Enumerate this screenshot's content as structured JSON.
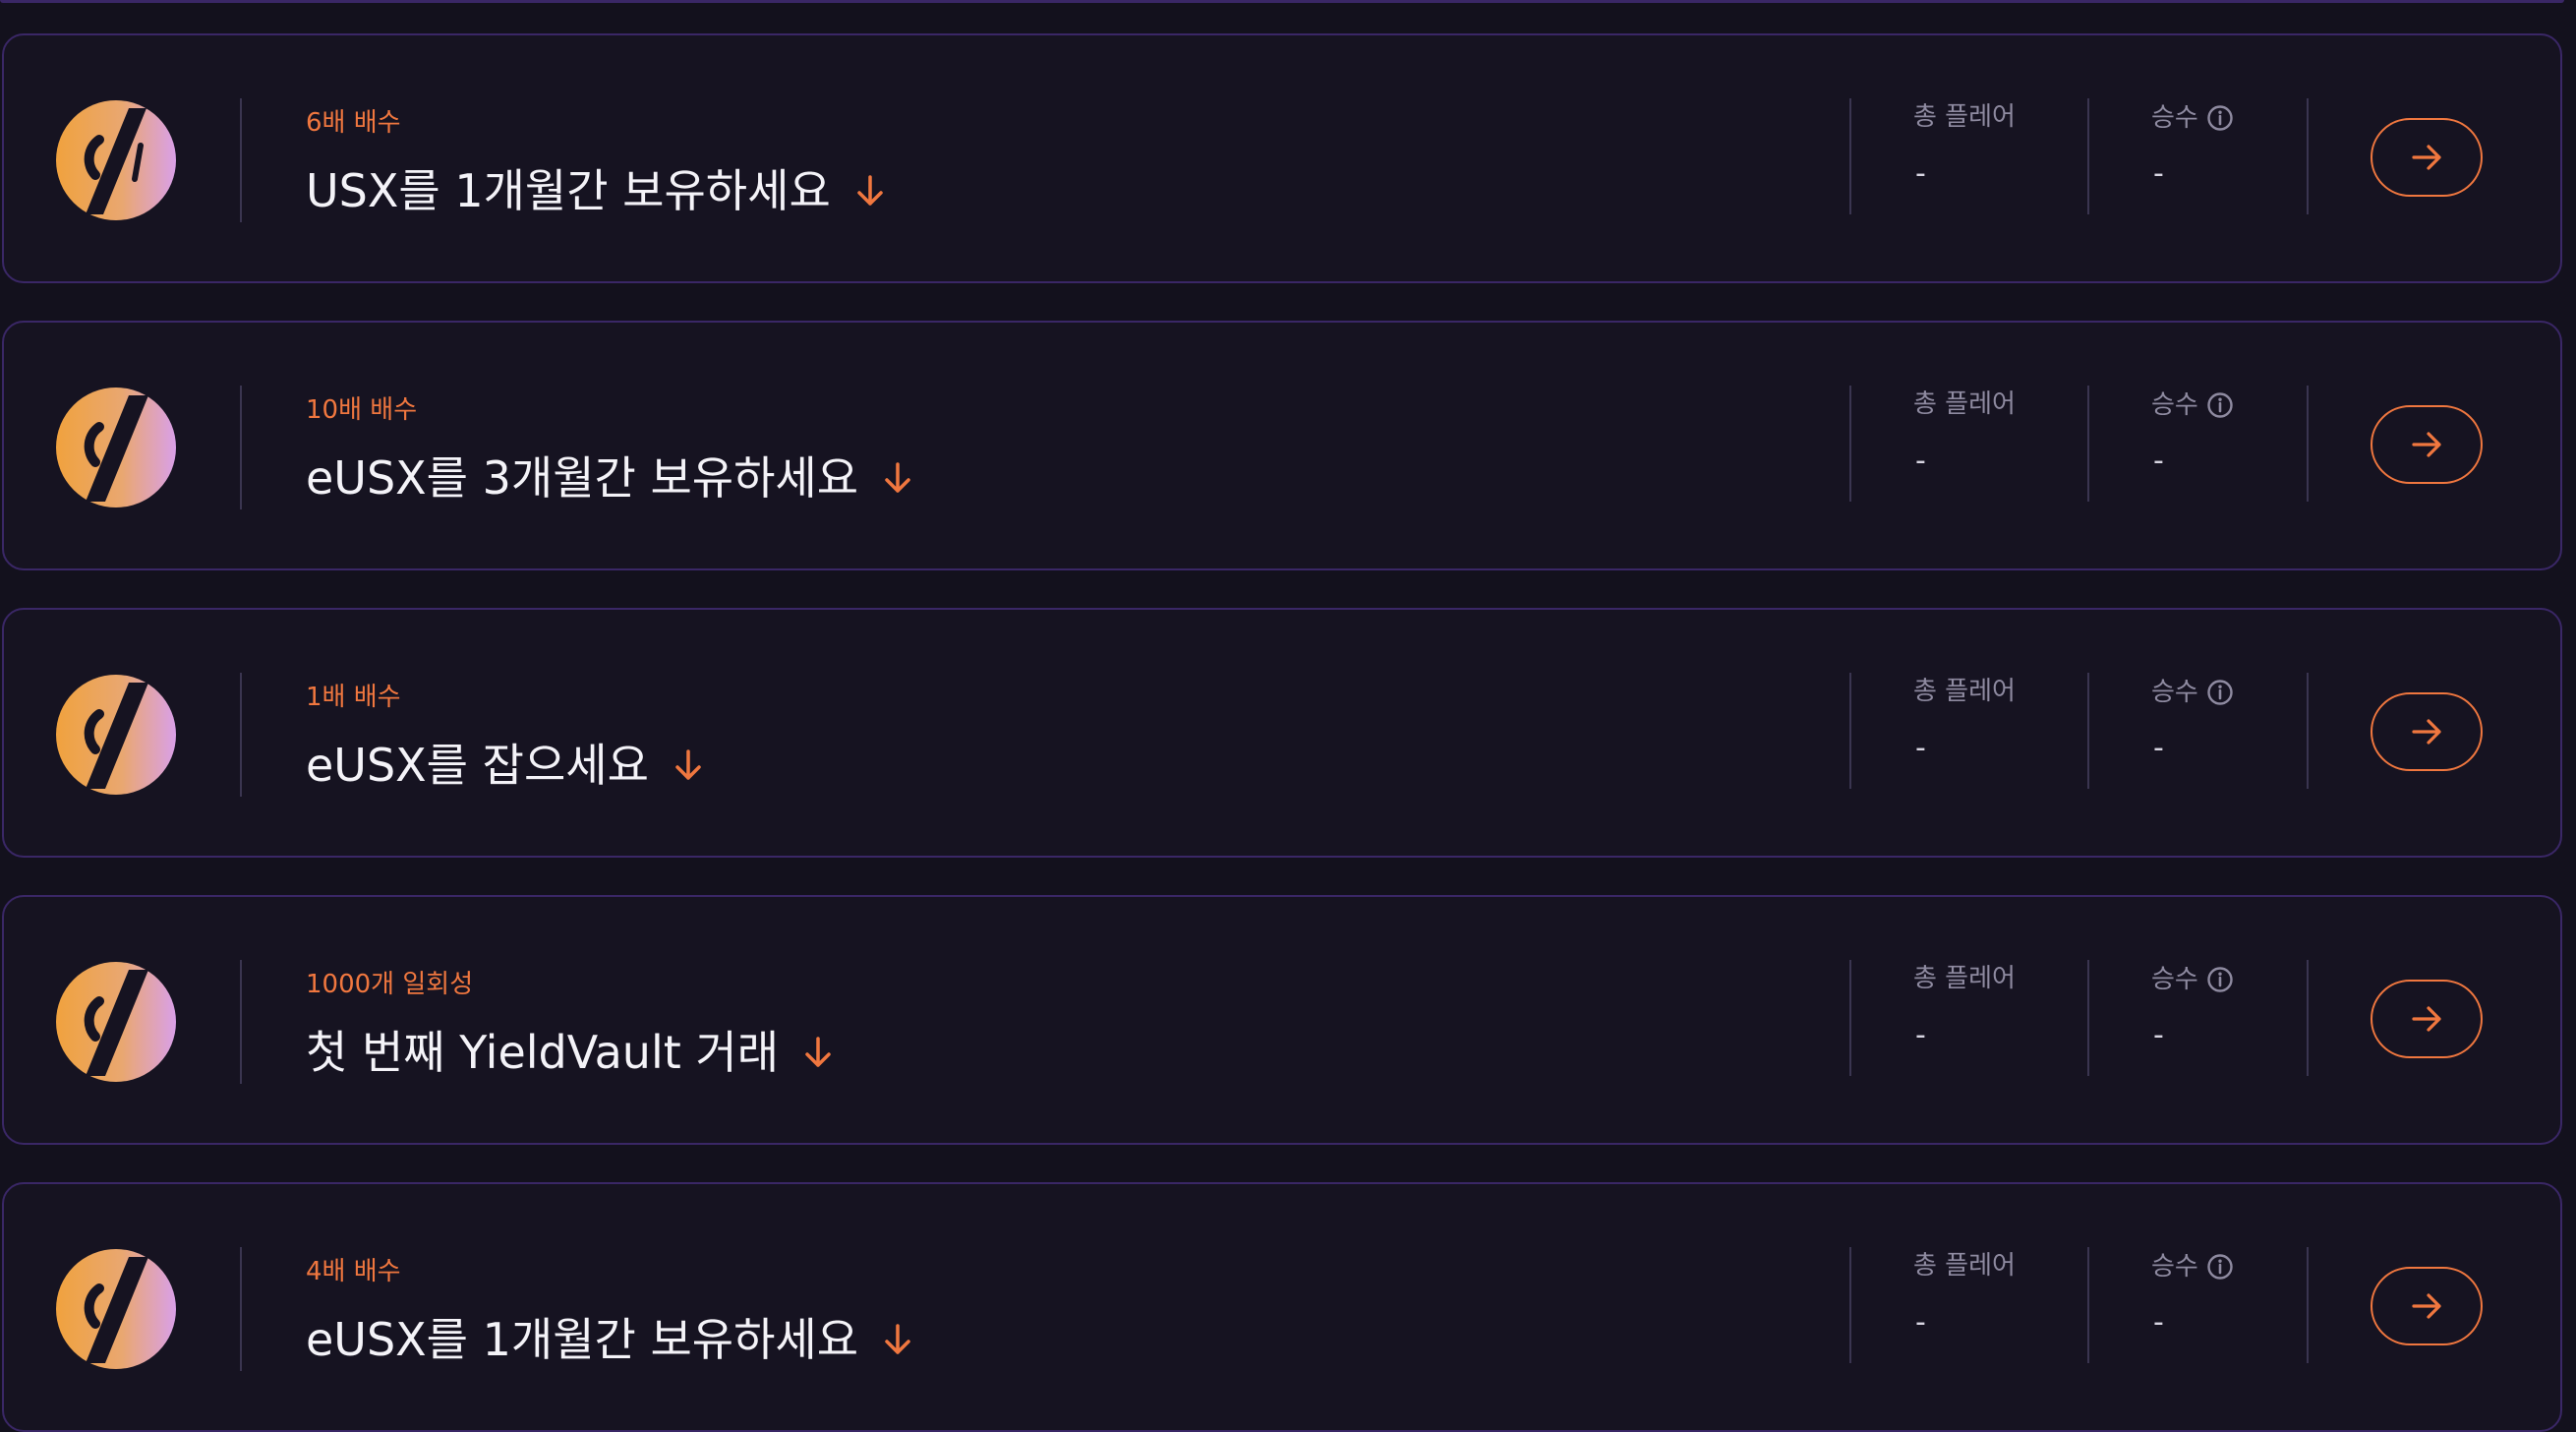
{
  "labels": {
    "total_players": "총 플레어",
    "wins": "승수"
  },
  "quests": [
    {
      "badge": "6배 배수",
      "title": "USX를 1개월간 보유하세요",
      "total_players": "-",
      "wins": "-",
      "logo": "usx-logo-icon"
    },
    {
      "badge": "10배 배수",
      "title": "eUSX를 3개월간 보유하세요",
      "total_players": "-",
      "wins": "-",
      "logo": "eusx-logo-icon"
    },
    {
      "badge": "1배 배수",
      "title": "eUSX를 잡으세요",
      "total_players": "-",
      "wins": "-",
      "logo": "eusx-logo-icon"
    },
    {
      "badge": "1000개 일회성",
      "title": "첫 번째 YieldVault 거래",
      "total_players": "-",
      "wins": "-",
      "logo": "eusx-logo-icon"
    },
    {
      "badge": "4배 배수",
      "title": "eUSX를 1개월간 보유하세요",
      "total_players": "-",
      "wins": "-",
      "logo": "eusx-logo-icon"
    }
  ],
  "icons": {
    "expand": "arrow-down-icon",
    "info": "info-icon",
    "go": "arrow-right-icon"
  },
  "colors": {
    "accent": "#f0773f",
    "background": "#13111d",
    "card_border": "#3a2766",
    "text_primary": "#f4f3f8",
    "text_muted": "#8e8aa0",
    "logo_gradient": [
      "#f0a23e",
      "#e9a770",
      "#d9a0e8"
    ]
  }
}
